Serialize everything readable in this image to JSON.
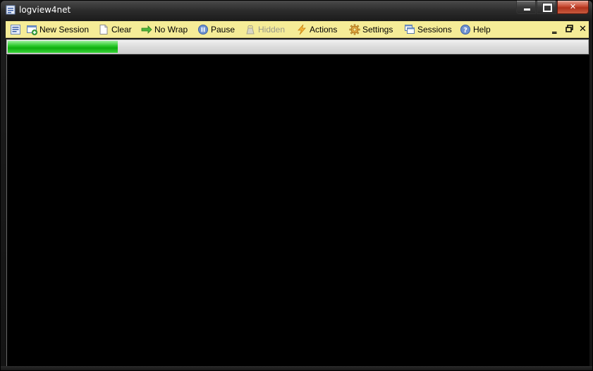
{
  "window": {
    "title": "logview4net"
  },
  "toolbar": {
    "items": [
      {
        "label": "New Session",
        "icon": "new-session-icon",
        "enabled": true
      },
      {
        "label": "Clear",
        "icon": "clear-page-icon",
        "enabled": true
      },
      {
        "label": "No Wrap",
        "icon": "arrow-right-icon",
        "enabled": true
      },
      {
        "label": "Pause",
        "icon": "pause-icon",
        "enabled": true
      },
      {
        "label": "Hidden",
        "icon": "hidden-icon",
        "enabled": false
      },
      {
        "label": "Actions",
        "icon": "lightning-icon",
        "enabled": true
      },
      {
        "label": "Settings",
        "icon": "gear-icon",
        "enabled": true
      },
      {
        "label": "Sessions",
        "icon": "windows-icon",
        "enabled": true
      },
      {
        "label": "Help",
        "icon": "help-icon",
        "enabled": true
      }
    ],
    "mdi_controls": {
      "minimize": "‗",
      "restore": "🗗",
      "close": "✕"
    }
  },
  "progress": {
    "fraction": 0.19,
    "color": "#1fbf1f"
  },
  "colors": {
    "toolbar_bg": "#f5ec97",
    "log_bg": "#000000"
  }
}
